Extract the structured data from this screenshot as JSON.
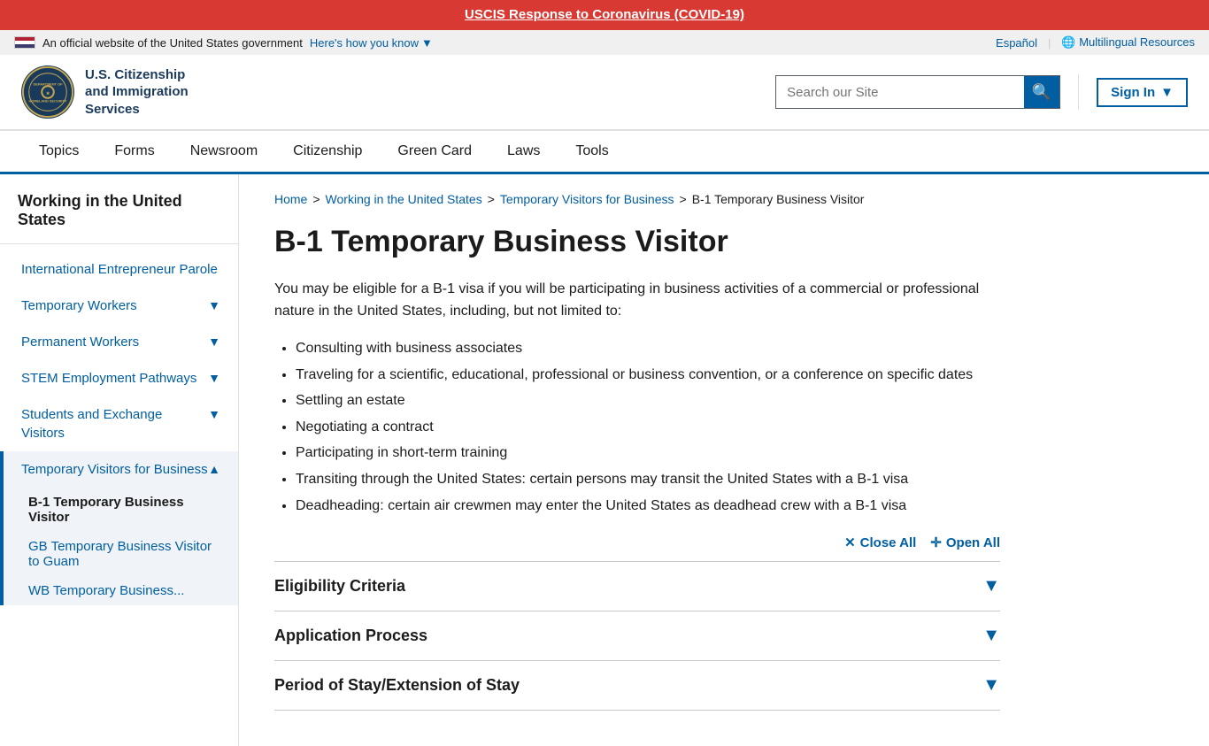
{
  "covid_banner": {
    "text": "USCIS Response to Coronavirus (COVID-19)",
    "url": "#"
  },
  "gov_bar": {
    "official_text": "An official website of the United States government",
    "how_know": "Here's how you know",
    "espanol": "Español",
    "multilingual": "Multilingual Resources"
  },
  "header": {
    "logo_line1": "U.S. Citizenship",
    "logo_line2": "and Immigration",
    "logo_line3": "Services",
    "search_placeholder": "Search our Site",
    "search_label": "Search our Site",
    "sign_in": "Sign In"
  },
  "nav": {
    "items": [
      {
        "label": "Topics"
      },
      {
        "label": "Forms"
      },
      {
        "label": "Newsroom"
      },
      {
        "label": "Citizenship"
      },
      {
        "label": "Green Card"
      },
      {
        "label": "Laws"
      },
      {
        "label": "Tools"
      }
    ]
  },
  "breadcrumb": {
    "items": [
      {
        "label": "Home",
        "url": "#"
      },
      {
        "label": "Working in the United States",
        "url": "#"
      },
      {
        "label": "Temporary Visitors for Business",
        "url": "#"
      },
      {
        "label": "B-1 Temporary Business Visitor"
      }
    ]
  },
  "page": {
    "title": "B-1 Temporary Business Visitor",
    "intro": "You may be eligible for a B-1 visa if you will be participating in business activities of a commercial or professional nature in the United States, including, but not limited to:",
    "bullet_items": [
      "Consulting with business associates",
      "Traveling for a scientific, educational, professional or business convention, or a conference on specific dates",
      "Settling an estate",
      "Negotiating a contract",
      "Participating in short-term training",
      "Transiting through the United States: certain persons may transit the United States with a B-1 visa",
      "Deadheading: certain air crewmen may enter the United States as deadhead crew with a B-1 visa"
    ],
    "close_all": "Close All",
    "open_all": "Open All",
    "accordion_items": [
      {
        "label": "Eligibility Criteria"
      },
      {
        "label": "Application Process"
      },
      {
        "label": "Period of Stay/Extension of Stay"
      }
    ]
  },
  "sidebar": {
    "title": "Working in the United States",
    "items": [
      {
        "label": "International Entrepreneur Parole",
        "has_expand": false,
        "active": false
      },
      {
        "label": "Temporary Workers",
        "has_expand": true,
        "active": false
      },
      {
        "label": "Permanent Workers",
        "has_expand": true,
        "active": false
      },
      {
        "label": "STEM Employment Pathways",
        "has_expand": true,
        "active": false
      },
      {
        "label": "Students and Exchange Visitors",
        "has_expand": true,
        "active": false
      },
      {
        "label": "Temporary Visitors for Business",
        "has_expand": true,
        "active": true,
        "sub_items": [
          {
            "label": "B-1 Temporary Business Visitor",
            "active": true
          },
          {
            "label": "GB Temporary Business Visitor to Guam",
            "active": false
          },
          {
            "label": "WB Temporary Business...",
            "active": false
          }
        ]
      }
    ]
  }
}
